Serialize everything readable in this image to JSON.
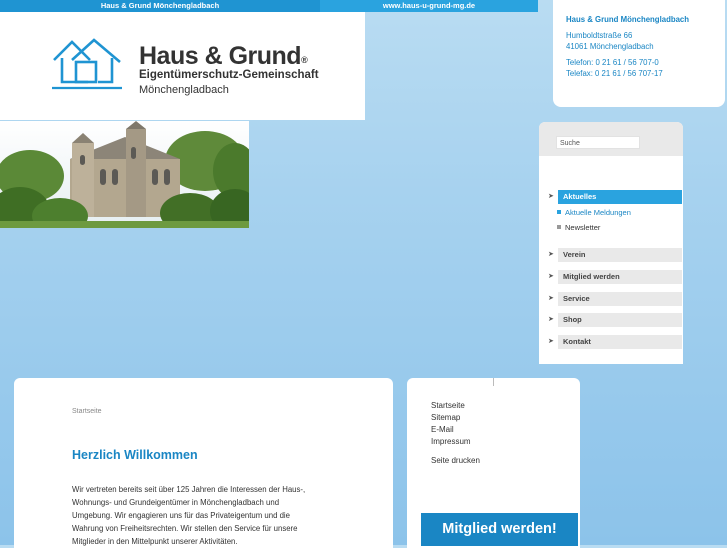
{
  "topbar": {
    "left_text": "Haus & Grund Mönchengladbach",
    "right_text": "www.haus-u-grund-mg.de"
  },
  "logo": {
    "brand": "Haus & Grund",
    "reg": "®",
    "tagline": "Eigentümerschutz-Gemeinschaft",
    "city": "Mönchengladbach"
  },
  "contact": {
    "name": "Haus & Grund Mönchengladbach",
    "street": "Humboldtstraße 66",
    "city": "41061 Mönchengladbach",
    "phone": "Telefon: 0 21 61 / 56 707-0",
    "fax": "Telefax: 0 21 61 / 56 707-17"
  },
  "search": {
    "placeholder": "Suche"
  },
  "nav": {
    "items": [
      {
        "label": "Aktuelles"
      },
      {
        "label": "Verein"
      },
      {
        "label": "Mitglied werden"
      },
      {
        "label": "Service"
      },
      {
        "label": "Shop"
      },
      {
        "label": "Kontakt"
      }
    ],
    "subitems": [
      {
        "label": "Aktuelle Meldungen"
      },
      {
        "label": "Newsletter"
      }
    ]
  },
  "main": {
    "breadcrumb": "Startseite",
    "title": "Herzlich Willkommen",
    "lines": [
      "Wir vertreten bereits seit über 125 Jahren die Interessen der Haus-,",
      "Wohnungs- und Grundeigentümer in Mönchengladbach und",
      "Umgebung. Wir engagieren uns für das Privateigentum und die",
      "Wahrung von Freiheitsrechten. Wir stellen den Service für unsere",
      "Mitglieder in den Mittelpunkt unserer Aktivitäten."
    ]
  },
  "side": {
    "links": [
      "Startseite",
      "Sitemap",
      "E-Mail",
      "Impressum"
    ],
    "print": "Seite drucken",
    "banner": "Mitglied werden!"
  },
  "colors": {
    "accent": "#1a86c4",
    "topbar": "#1f94d2",
    "nav_active": "#2aa3df"
  }
}
